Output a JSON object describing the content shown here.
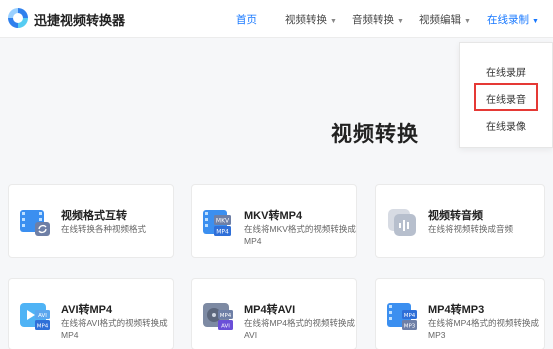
{
  "header": {
    "brand": "迅捷视频转换器",
    "nav": [
      {
        "label": "首页",
        "has_caret": false,
        "active": false
      },
      {
        "label": "视频转换",
        "has_caret": true,
        "active": false
      },
      {
        "label": "音频转换",
        "has_caret": true,
        "active": false
      },
      {
        "label": "视频编辑",
        "has_caret": true,
        "active": false
      },
      {
        "label": "在线录制",
        "has_caret": true,
        "active": true
      }
    ],
    "caret_glyph": "▼",
    "accent_color": "#1677ff"
  },
  "dropdown": {
    "items": [
      "在线录屏",
      "在线录音",
      "在线录像"
    ],
    "highlighted_item": "在线录音",
    "highlight_color": "#e53935"
  },
  "section": {
    "title": "视频转换"
  },
  "cards": [
    {
      "title": "视频格式互转",
      "desc": "在线转换各种视频格式",
      "icon": "video-convert-icon"
    },
    {
      "title": "MKV转MP4",
      "desc": "在线将MKV格式的视频转换成MP4",
      "icon": "mkv-to-mp4-icon",
      "badge_top": "MKV",
      "badge_bottom": "MP4"
    },
    {
      "title": "视频转音频",
      "desc": "在线将视频转换成音频",
      "icon": "video-to-audio-icon"
    },
    {
      "title": "AVI转MP4",
      "desc": "在线将AVI格式的视频转换成MP4",
      "icon": "avi-to-mp4-icon",
      "badge_top": "AVI",
      "badge_bottom": "MP4"
    },
    {
      "title": "MP4转AVI",
      "desc": "在线将MP4格式的视频转换成AVI",
      "icon": "mp4-to-avi-icon",
      "badge_top": "MP4",
      "badge_bottom": "AVI"
    },
    {
      "title": "MP4转MP3",
      "desc": "在线将MP4格式的视频转换成MP3",
      "icon": "mp4-to-mp3-icon",
      "badge_top": "MP4",
      "badge_bottom": "MP3"
    }
  ]
}
